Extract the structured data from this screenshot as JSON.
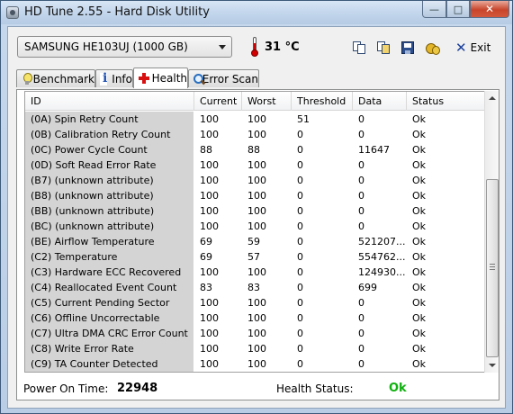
{
  "window": {
    "title": "HD Tune 2.55 - Hard Disk Utility",
    "minimize_glyph": "—",
    "maximize_glyph": "□",
    "close_glyph": "✕"
  },
  "toolbar": {
    "drive": "SAMSUNG HE103UJ (1000 GB)",
    "temperature": "31 °C",
    "exit_label": "Exit",
    "exit_glyph": "✕",
    "icons": [
      "copy-text-icon",
      "copy-screenshot-icon",
      "save-icon",
      "options-icon"
    ]
  },
  "tabs": [
    {
      "label": "Benchmark",
      "icon": "lightbulb-icon",
      "active": false
    },
    {
      "label": "Info",
      "icon": "info-icon",
      "active": false
    },
    {
      "label": "Health",
      "icon": "health-cross-icon",
      "active": true
    },
    {
      "label": "Error Scan",
      "icon": "magnifier-icon",
      "active": false
    }
  ],
  "table": {
    "columns": [
      "ID",
      "Current",
      "Worst",
      "Threshold",
      "Data",
      "Status"
    ],
    "rows": [
      [
        "(0A) Spin Retry Count",
        "100",
        "100",
        "51",
        "0",
        "Ok"
      ],
      [
        "(0B) Calibration Retry Count",
        "100",
        "100",
        "0",
        "0",
        "Ok"
      ],
      [
        "(0C) Power Cycle Count",
        "88",
        "88",
        "0",
        "11647",
        "Ok"
      ],
      [
        "(0D) Soft Read Error Rate",
        "100",
        "100",
        "0",
        "0",
        "Ok"
      ],
      [
        "(B7) (unknown attribute)",
        "100",
        "100",
        "0",
        "0",
        "Ok"
      ],
      [
        "(B8) (unknown attribute)",
        "100",
        "100",
        "0",
        "0",
        "Ok"
      ],
      [
        "(BB) (unknown attribute)",
        "100",
        "100",
        "0",
        "0",
        "Ok"
      ],
      [
        "(BC) (unknown attribute)",
        "100",
        "100",
        "0",
        "0",
        "Ok"
      ],
      [
        "(BE) Airflow Temperature",
        "69",
        "59",
        "0",
        "521207...",
        "Ok"
      ],
      [
        "(C2) Temperature",
        "69",
        "57",
        "0",
        "554762...",
        "Ok"
      ],
      [
        "(C3) Hardware ECC Recovered",
        "100",
        "100",
        "0",
        "124930...",
        "Ok"
      ],
      [
        "(C4) Reallocated Event Count",
        "83",
        "83",
        "0",
        "699",
        "Ok"
      ],
      [
        "(C5) Current Pending Sector",
        "100",
        "100",
        "0",
        "0",
        "Ok"
      ],
      [
        "(C6) Offline Uncorrectable",
        "100",
        "100",
        "0",
        "0",
        "Ok"
      ],
      [
        "(C7) Ultra DMA CRC Error Count",
        "100",
        "100",
        "0",
        "0",
        "Ok"
      ],
      [
        "(C8) Write Error Rate",
        "100",
        "100",
        "0",
        "0",
        "Ok"
      ],
      [
        "(C9) TA Counter Detected",
        "100",
        "100",
        "0",
        "0",
        "Ok"
      ]
    ]
  },
  "footer": {
    "power_on_label": "Power On Time:",
    "power_on_value": "22948",
    "health_label": "Health Status:",
    "health_value": "Ok",
    "health_color": "#10b010"
  }
}
